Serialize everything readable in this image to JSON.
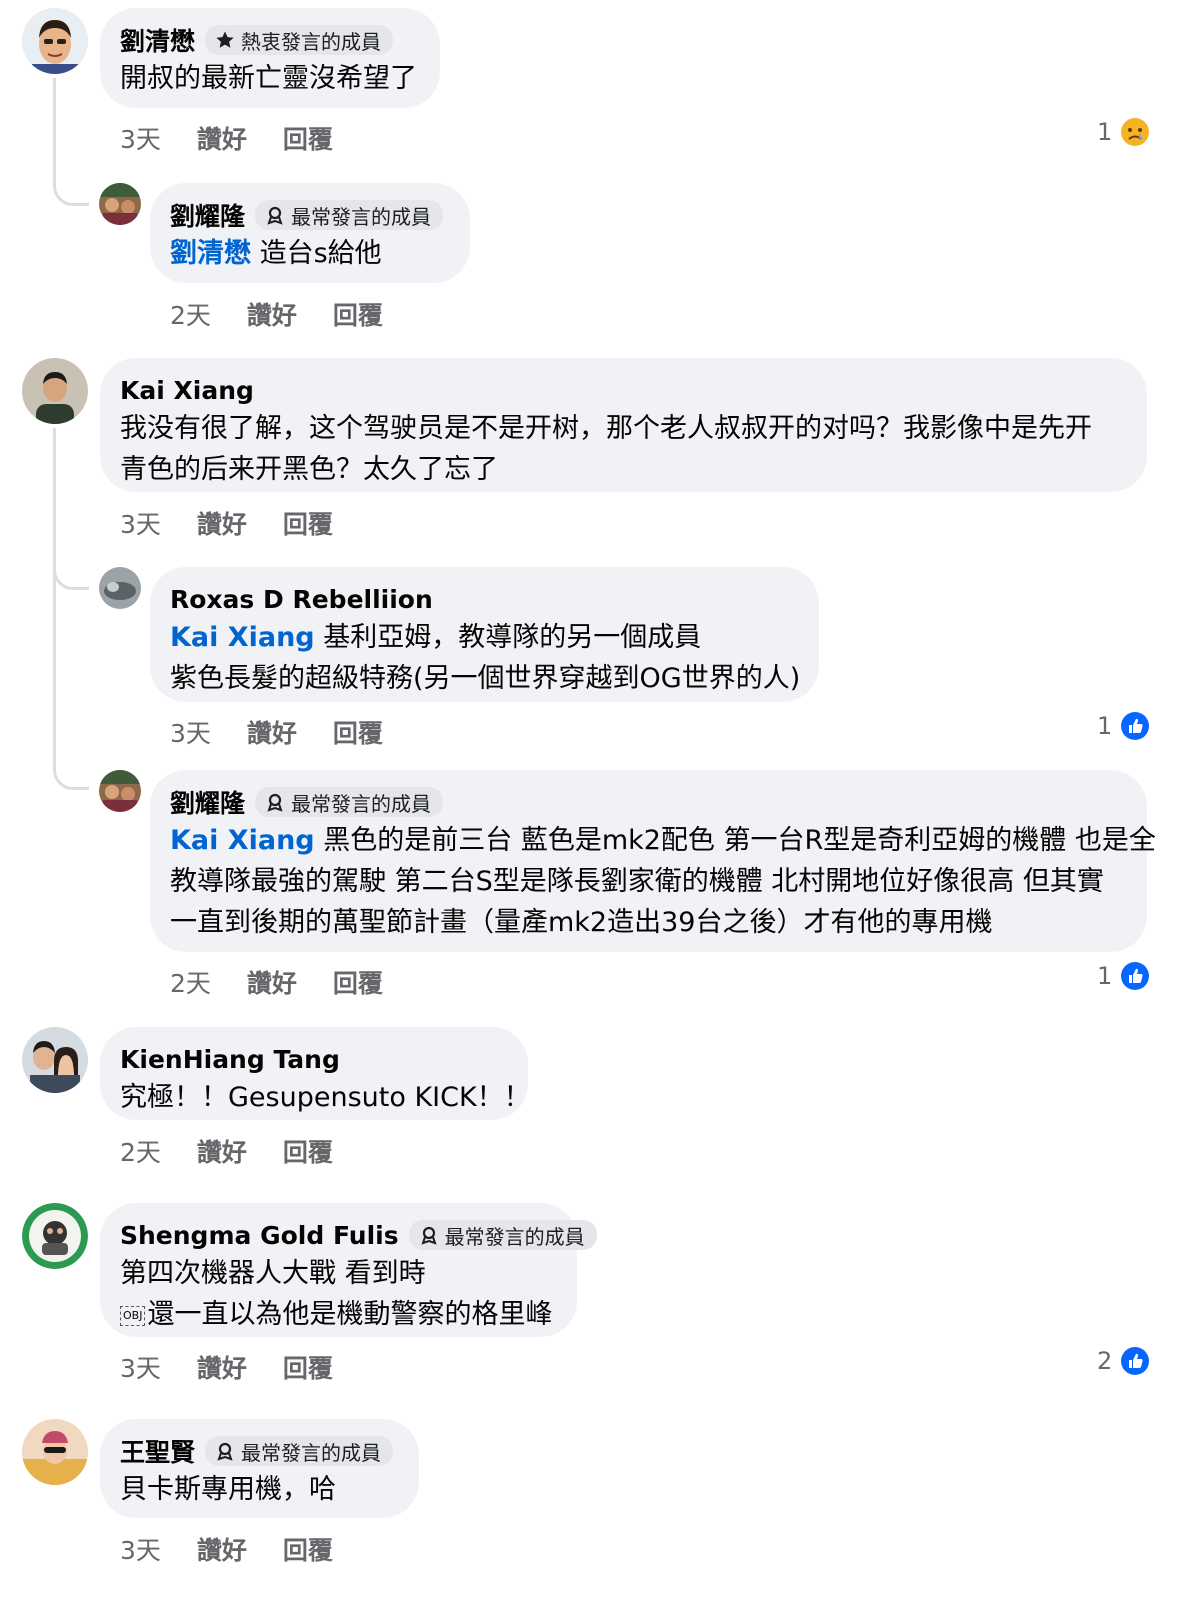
{
  "comments": [
    {
      "name": "劉清懋",
      "badge": "熱衷發言的成員",
      "lines": [
        "開叔的最新亡靈沒希望了"
      ],
      "time": "3天",
      "like": "讚好",
      "reply": "回覆",
      "reaction": {
        "count": "1",
        "icon": "sad-face-icon"
      },
      "replies": [
        {
          "name": "劉耀隆",
          "badge": "最常發言的成員",
          "mention": "劉清懋",
          "lines": [
            "造台s給他"
          ],
          "time": "2天",
          "like": "讚好",
          "reply": "回覆"
        }
      ]
    },
    {
      "name": "Kai Xiang",
      "lines": [
        "我没有很了解，这个驾驶员是不是开树，那个老人叔叔开的对吗？我影像中是先开",
        "青色的后来开黑色？太久了忘了"
      ],
      "time": "3天",
      "like": "讚好",
      "reply": "回覆",
      "replies": [
        {
          "name": "Roxas D Rebelliion",
          "mention": "Kai Xiang",
          "lines": [
            "基利亞姆，教導隊的另一個成員",
            "紫色長髮的超級特務(另一個世界穿越到OG世界的人)"
          ],
          "time": "3天",
          "like": "讚好",
          "reply": "回覆",
          "reaction": {
            "count": "1",
            "icon": "like-icon"
          }
        },
        {
          "name": "劉耀隆",
          "badge": "最常發言的成員",
          "mention": "Kai Xiang",
          "lines": [
            "黑色的是前三台 藍色是mk2配色 第一台R型是奇利亞姆的機體 也是全",
            "教導隊最強的駕駛 第二台S型是隊長劉家衛的機體 北村開地位好像很高 但其實",
            "一直到後期的萬聖節計畫（量產mk2造出39台之後）才有他的專用機"
          ],
          "time": "2天",
          "like": "讚好",
          "reply": "回覆",
          "reaction": {
            "count": "1",
            "icon": "like-icon"
          }
        }
      ]
    },
    {
      "name": "KienHiang Tang",
      "lines": [
        "究極！！Gesupensuto KICK！！"
      ],
      "time": "2天",
      "like": "讚好",
      "reply": "回覆"
    },
    {
      "name": "Shengma Gold Fulis",
      "badge": "最常發言的成員",
      "lines": [
        "第四次機器人大戰 看到時",
        "還一直以為他是機動警察的格里峰"
      ],
      "obj_label": "OBJ",
      "time": "3天",
      "like": "讚好",
      "reply": "回覆",
      "reaction": {
        "count": "2",
        "icon": "like-icon"
      }
    },
    {
      "name": "王聖賢",
      "badge": "最常發言的成員",
      "lines": [
        "貝卡斯專用機，哈"
      ],
      "time": "3天",
      "like": "讚好",
      "reply": "回覆"
    }
  ],
  "colors": {
    "bubble": "#f0f2f5",
    "mention": "#0064d1",
    "meta": "#65676b",
    "like_blue": "#0866ff"
  }
}
